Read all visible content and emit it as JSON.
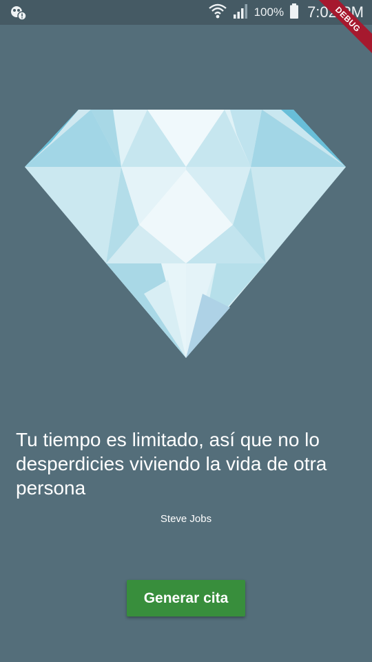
{
  "status_bar": {
    "battery": "100%",
    "time": "7:02 PM",
    "icons": [
      "notification-icon",
      "wifi-icon",
      "signal-icon",
      "battery-icon"
    ]
  },
  "debug_banner": "DEBUG",
  "quote": {
    "text": "Tu tiempo es limitado, así que no lo desperdicies viviendo la vida de otra persona",
    "author": "Steve Jobs"
  },
  "button": {
    "label": "Generar cita"
  },
  "colors": {
    "background": "#546e7a",
    "status_bar": "#455a64",
    "button": "#388e3c",
    "debug_ribbon": "#a6192e"
  },
  "image": {
    "name": "diamond-icon"
  }
}
